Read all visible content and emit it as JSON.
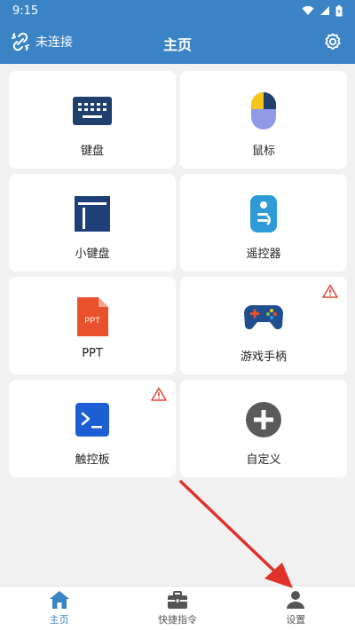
{
  "status": {
    "time": "9:15"
  },
  "header": {
    "title": "主页",
    "connection_label": "未连接"
  },
  "tiles": [
    {
      "label": "键盘",
      "icon": "keyboard-icon",
      "warning": false
    },
    {
      "label": "鼠标",
      "icon": "mouse-icon",
      "warning": false
    },
    {
      "label": "小键盘",
      "icon": "numpad-icon",
      "warning": false
    },
    {
      "label": "遥控器",
      "icon": "remote-control-icon",
      "warning": false
    },
    {
      "label": "PPT",
      "icon": "ppt-file-icon",
      "icon_text": "PPT",
      "warning": false
    },
    {
      "label": "游戏手柄",
      "icon": "gamepad-icon",
      "warning": true
    },
    {
      "label": "触控板",
      "icon": "terminal-touchpad-icon",
      "warning": true
    },
    {
      "label": "自定义",
      "icon": "plus-circle-icon",
      "warning": false
    }
  ],
  "nav": [
    {
      "label": "主页",
      "icon": "home-icon",
      "active": true
    },
    {
      "label": "快捷指令",
      "icon": "toolbox-icon",
      "active": false
    },
    {
      "label": "设置",
      "icon": "person-icon",
      "active": false
    }
  ],
  "colors": {
    "primary": "#3a84c5",
    "warning": "#e24a3b",
    "arrow": "#e0312b"
  }
}
